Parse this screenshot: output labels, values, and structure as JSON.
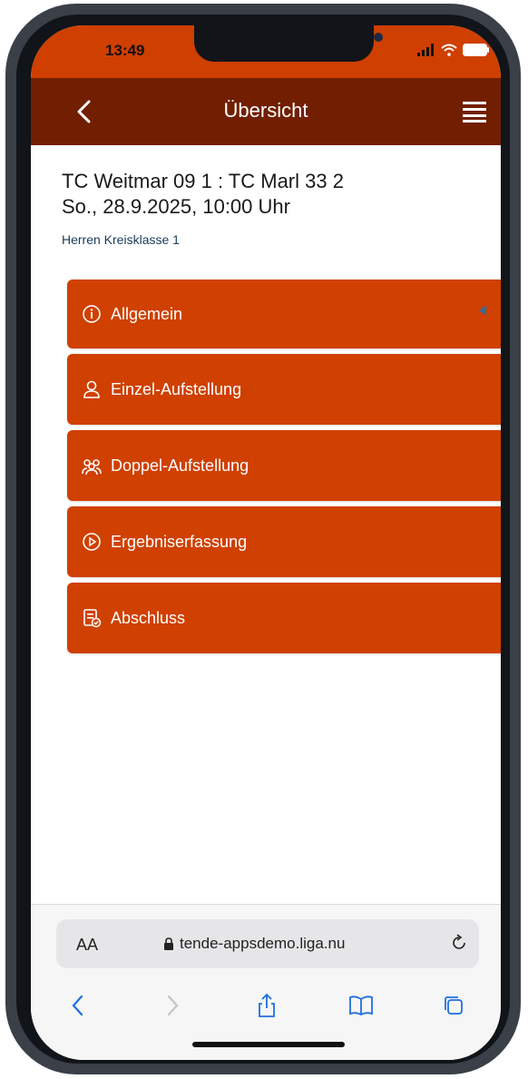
{
  "status_bar": {
    "time": "13:49"
  },
  "nav": {
    "title": "Übersicht"
  },
  "match": {
    "teams": "TC Weitmar 09 1 : TC Marl 33 2",
    "datetime": "So., 28.9.2025, 10:00 Uhr",
    "league": "Herren Kreisklasse 1"
  },
  "menu": [
    {
      "label": "Allgemein",
      "icon": "info-icon"
    },
    {
      "label": "Einzel-Aufstellung",
      "icon": "person-icon"
    },
    {
      "label": "Doppel-Aufstellung",
      "icon": "group-icon"
    },
    {
      "label": "Ergebniserfassung",
      "icon": "play-circle-icon"
    },
    {
      "label": "Abschluss",
      "icon": "document-check-icon"
    }
  ],
  "browser": {
    "text_size_label": "AA",
    "url": "tende-appsdemo.liga.nu"
  },
  "colors": {
    "status_bar": "#cf3f00",
    "nav_bar": "#711f00",
    "menu_button": "#d04000",
    "league_text": "#1a3a5c",
    "browser_icons": "#1f6fe0"
  }
}
